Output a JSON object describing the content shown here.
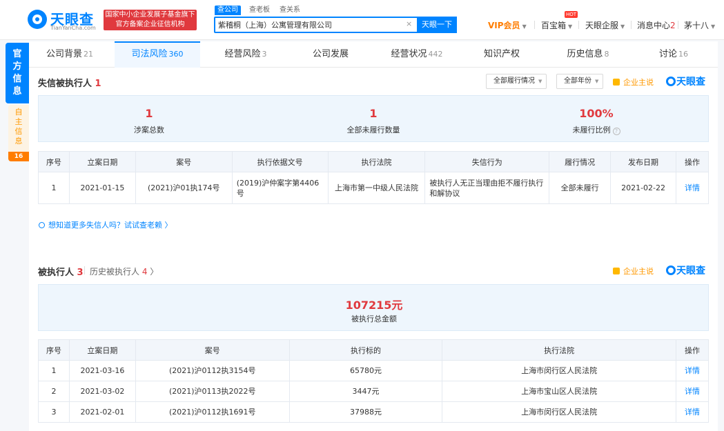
{
  "header": {
    "logo_text": "天眼查",
    "logo_sub": "TianYanCha.com",
    "badge_line1": "国家中小企业发展子基金旗下",
    "badge_line2": "官方备案企业征信机构",
    "search_tabs": [
      "查公司",
      "查老板",
      "查关系"
    ],
    "search_value": "紫稽桐（上海）公寓管理有限公司",
    "search_clear": "×",
    "search_button": "天眼一下",
    "vip": "VIP会员",
    "baibao": "百宝箱",
    "hot": "HOT",
    "enterprise": "天眼企服",
    "message": "消息中心",
    "message_count": "2",
    "user": "茅十八"
  },
  "rail": {
    "official": "官方信息",
    "self": "自主信息",
    "self_count": "16"
  },
  "tabs": [
    {
      "label": "公司背景",
      "count": "21"
    },
    {
      "label": "司法风险",
      "count": "360"
    },
    {
      "label": "经营风险",
      "count": "3"
    },
    {
      "label": "公司发展",
      "count": ""
    },
    {
      "label": "经营状况",
      "count": "442"
    },
    {
      "label": "知识产权",
      "count": ""
    },
    {
      "label": "历史信息",
      "count": "8"
    },
    {
      "label": "讨论",
      "count": "16"
    }
  ],
  "dishonest": {
    "title": "失信被执行人",
    "count": "1",
    "filter1": "全部履行情况",
    "filter2": "全部年份",
    "corp_say": "企业主说",
    "brand": "天眼查",
    "stats": [
      {
        "value": "1",
        "label": "涉案总数"
      },
      {
        "value": "1",
        "label": "全部未履行数量"
      },
      {
        "value": "100%",
        "label": "未履行比例"
      }
    ],
    "help_icon": "?",
    "headers": [
      "序号",
      "立案日期",
      "案号",
      "执行依据文号",
      "执行法院",
      "失信行为",
      "履行情况",
      "发布日期",
      "操作"
    ],
    "rows": [
      [
        "1",
        "2021-01-15",
        "(2021)沪01执174号",
        "(2019)沪仲案字第4406号",
        "上海市第一中级人民法院",
        "被执行人无正当理由拒不履行执行和解协议",
        "全部未履行",
        "2021-02-22",
        "详情"
      ]
    ],
    "tip": "想知道更多失信人吗？试试查老赖 〉"
  },
  "executed": {
    "title": "被执行人",
    "count": "3",
    "history_label": "历史被执行人",
    "history_count": "4",
    "corp_say": "企业主说",
    "brand": "天眼查",
    "total_amount": "107215元",
    "total_label": "被执行总金额",
    "headers": [
      "序号",
      "立案日期",
      "案号",
      "执行标的",
      "执行法院",
      "操作"
    ],
    "rows": [
      [
        "1",
        "2021-03-16",
        "(2021)沪0112执3154号",
        "65780元",
        "上海市闵行区人民法院",
        "详情"
      ],
      [
        "2",
        "2021-03-02",
        "(2021)沪0113执2022号",
        "3447元",
        "上海市宝山区人民法院",
        "详情"
      ],
      [
        "3",
        "2021-02-01",
        "(2021)沪0112执1691号",
        "37988元",
        "上海市闵行区人民法院",
        "详情"
      ]
    ]
  },
  "colors": {
    "brand_blue": "#0084ff",
    "risk_red": "#e0393e",
    "vip_orange": "#ff7d00"
  }
}
